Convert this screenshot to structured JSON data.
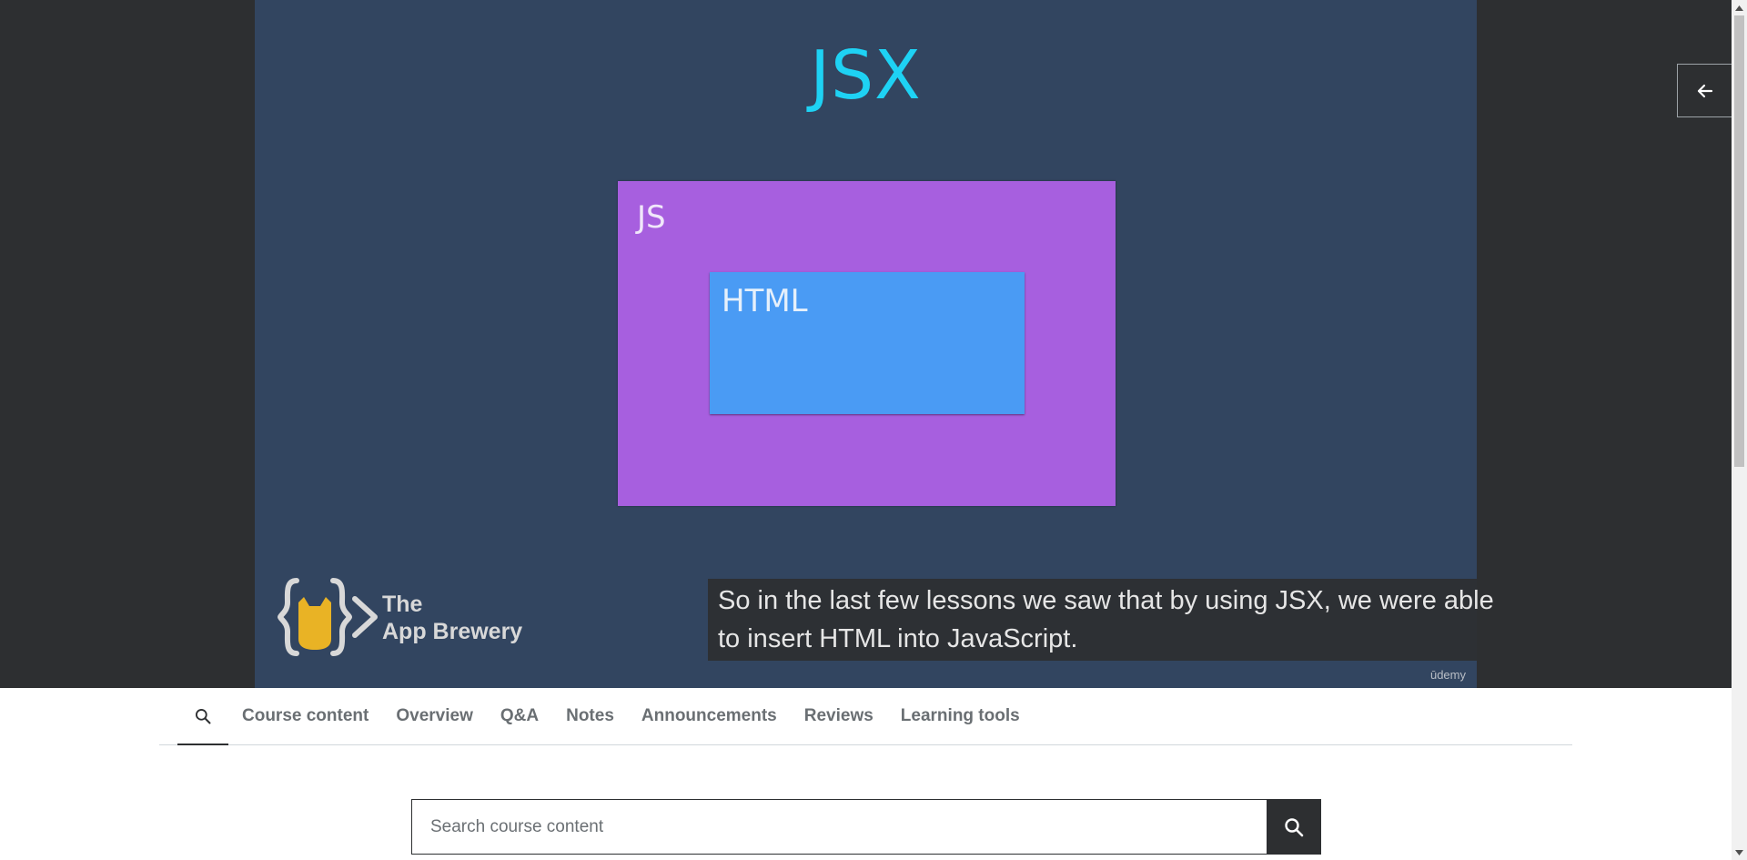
{
  "video": {
    "slide_title": "JSX",
    "outer_box_label": "JS",
    "inner_box_label": "HTML",
    "brand": {
      "line1": "The",
      "line2": "App Brewery"
    },
    "caption": "So in the last few lessons we saw that by using JSX, we were able to insert HTML into JavaScript.",
    "watermark": "ūdemy",
    "collapse_icon": "arrow-left-icon"
  },
  "tabs": [
    {
      "label": "",
      "icon": "search-icon",
      "active": true
    },
    {
      "label": "Course content"
    },
    {
      "label": "Overview"
    },
    {
      "label": "Q&A"
    },
    {
      "label": "Notes"
    },
    {
      "label": "Announcements"
    },
    {
      "label": "Reviews"
    },
    {
      "label": "Learning tools"
    }
  ],
  "search": {
    "placeholder": "Search course content",
    "value": "",
    "button_icon": "search-icon"
  },
  "colors": {
    "slide_bg": "#324560",
    "title": "#1ed2f4",
    "js_box": "#a75fdf",
    "html_box": "#4a9bf4",
    "page_dark": "#2d2f31"
  }
}
